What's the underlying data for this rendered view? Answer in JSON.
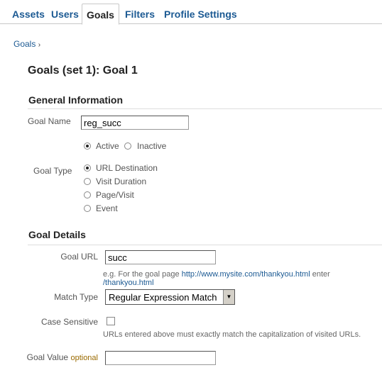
{
  "tabs": [
    {
      "label": "Assets"
    },
    {
      "label": "Users"
    },
    {
      "label": "Goals",
      "active": true
    },
    {
      "label": "Filters"
    },
    {
      "label": "Profile Settings"
    }
  ],
  "breadcrumb": {
    "label": "Goals",
    "separator": "›"
  },
  "page_title": "Goals (set 1): Goal 1",
  "general": {
    "heading": "General Information",
    "goal_name_label": "Goal Name",
    "goal_name_value": "reg_succ",
    "status_options": [
      {
        "label": "Active",
        "checked": true
      },
      {
        "label": "Inactive",
        "checked": false
      }
    ],
    "goal_type_label": "Goal Type",
    "goal_type_options": [
      {
        "label": "URL Destination",
        "checked": true
      },
      {
        "label": "Visit Duration",
        "checked": false
      },
      {
        "label": "Page/Visit",
        "checked": false
      },
      {
        "label": "Event",
        "checked": false
      }
    ]
  },
  "details": {
    "heading": "Goal Details",
    "goal_url_label": "Goal URL",
    "goal_url_value": "succ",
    "hint_prefix": "e.g. For the goal page",
    "hint_link1": "http://www.mysite.com/thankyou.html",
    "hint_mid": "enter",
    "hint_link2": "/thankyou.html",
    "match_type_label": "Match Type",
    "match_type_value": "Regular Expression Match",
    "case_label": "Case Sensitive",
    "case_checked": false,
    "case_hint": "URLs entered above must exactly match the capitalization of visited URLs.",
    "goal_value_label": "Goal Value",
    "goal_value_optional": "optional",
    "goal_value_value": ""
  },
  "colors": {
    "link": "#1c5a93",
    "optional": "#9a6a00"
  }
}
